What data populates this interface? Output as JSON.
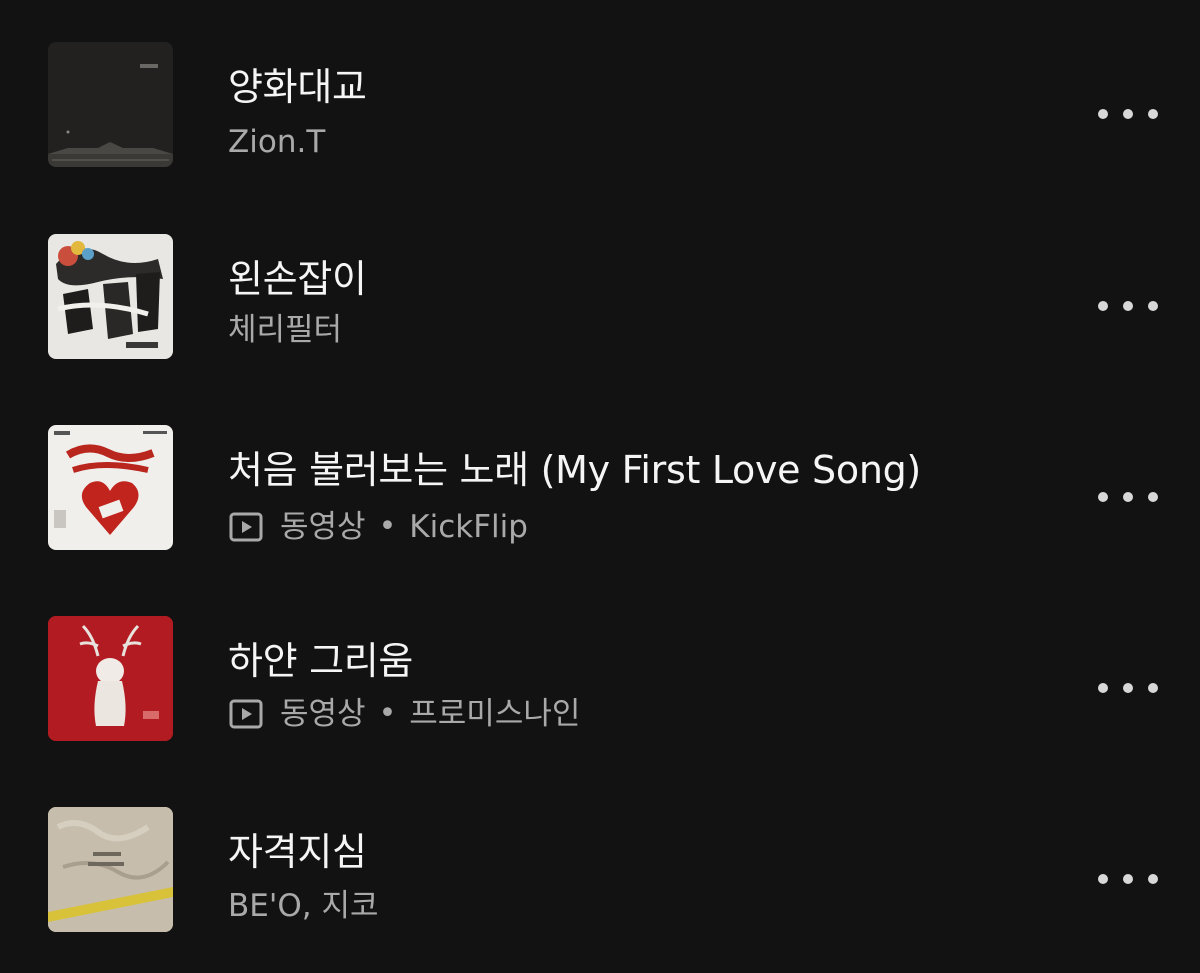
{
  "tracks": [
    {
      "title": "양화대교",
      "video_label": "",
      "artist": "Zion.T",
      "has_video": false,
      "art": "dark-bridge"
    },
    {
      "title": "왼손잡이",
      "video_label": "",
      "artist": "체리필터",
      "has_video": false,
      "art": "graffiti"
    },
    {
      "title": "처음 불러보는 노래 (My First Love Song)",
      "video_label": "동영상",
      "artist": "KickFlip",
      "has_video": true,
      "art": "red-heart"
    },
    {
      "title": "하얀 그리움",
      "video_label": "동영상",
      "artist": "프로미스나인",
      "has_video": true,
      "art": "red-cat"
    },
    {
      "title": "자격지심",
      "video_label": "",
      "artist": "BE'O, 지코",
      "has_video": false,
      "art": "beige-fur"
    }
  ],
  "separator": "•",
  "icons": {
    "more": "more-horizontal-icon",
    "video": "play-square-icon"
  },
  "colors": {
    "background": "#121212",
    "title": "#f5f5f5",
    "subtitle": "#a9a9a9"
  }
}
